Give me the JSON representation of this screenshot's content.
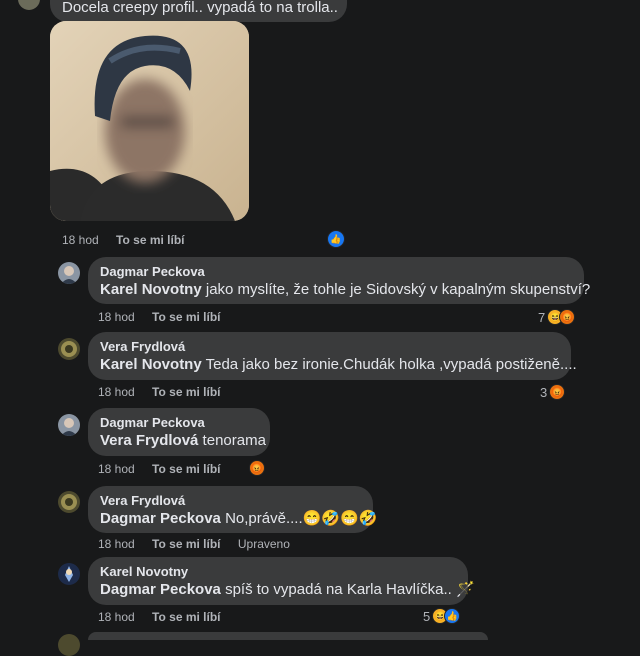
{
  "top_comment": {
    "text": "Docela creepy profil.. vypadá to na trolla..",
    "time": "18 hod",
    "like_label": "To se mi líbí"
  },
  "comments": [
    {
      "author": "Dagmar Peckova",
      "mention": "Karel Novotny",
      "text": " jako myslíte, že tohle je Sidovský v kapalným skupenství?",
      "time": "18 hod",
      "like_label": "To se mi líbí",
      "reaction_count": "7",
      "reactions": [
        "haha",
        "angry"
      ]
    },
    {
      "author": "Vera Frydlová",
      "mention": "Karel Novotny",
      "text": " Teda jako bez ironie.Chudák holka ,vypadá postiženě....",
      "time": "18 hod",
      "like_label": "To se mi líbí",
      "reaction_count": "3",
      "reactions": [
        "angry"
      ]
    },
    {
      "author": "Dagmar Peckova",
      "mention": "Vera Frydlová",
      "text": " tenorama",
      "time": "18 hod",
      "like_label": "To se mi líbí",
      "reaction_count": "",
      "reactions": [
        "angry"
      ]
    },
    {
      "author": "Vera Frydlová",
      "mention": "Dagmar Peckova",
      "text": " No,právě....😁🤣😁🤣",
      "time": "18 hod",
      "like_label": "To se mi líbí",
      "edited_label": "Upraveno"
    },
    {
      "author": "Karel Novotny",
      "mention": "Dagmar Peckova",
      "text": " spíš to vypadá na Karla Havlíčka.. 🪄",
      "time": "18 hod",
      "like_label": "To se mi líbí",
      "reaction_count": "5",
      "reactions": [
        "haha",
        "like"
      ]
    }
  ],
  "colors": {
    "background": "#18191a",
    "bubble": "#3a3b3c",
    "text": "#e4e6eb",
    "meta": "#b0b3b8",
    "like_blue": "#1877f2",
    "haha_yellow": "#f7b125",
    "angry_orange": "#e9710f"
  }
}
